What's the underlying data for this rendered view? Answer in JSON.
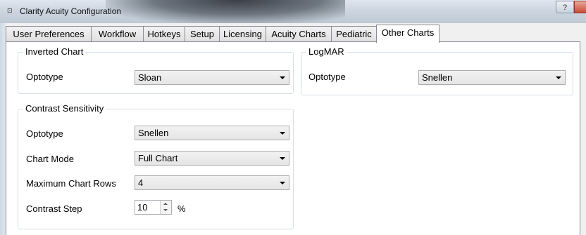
{
  "window": {
    "title": "Clarity Acuity Configuration",
    "help_label": "?"
  },
  "tabs": [
    {
      "label": "User Preferences"
    },
    {
      "label": "Workflow"
    },
    {
      "label": "Hotkeys"
    },
    {
      "label": "Setup"
    },
    {
      "label": "Licensing"
    },
    {
      "label": "Acuity Charts"
    },
    {
      "label": "Pediatric"
    },
    {
      "label": "Other Charts",
      "active": true
    }
  ],
  "inverted_chart": {
    "title": "Inverted Chart",
    "optotype_label": "Optotype",
    "optotype_value": "Sloan"
  },
  "logmar": {
    "title": "LogMAR",
    "optotype_label": "Optotype",
    "optotype_value": "Snellen"
  },
  "contrast_sensitivity": {
    "title": "Contrast Sensitivity",
    "optotype_label": "Optotype",
    "optotype_value": "Snellen",
    "chart_mode_label": "Chart Mode",
    "chart_mode_value": "Full Chart",
    "max_rows_label": "Maximum Chart Rows",
    "max_rows_value": "4",
    "contrast_step_label": "Contrast Step",
    "contrast_step_value": "10",
    "contrast_step_unit": "%"
  },
  "colors": {
    "tab_border": "#898c95",
    "group_border": "#d5dfe5",
    "close_button": "#c94a32"
  }
}
